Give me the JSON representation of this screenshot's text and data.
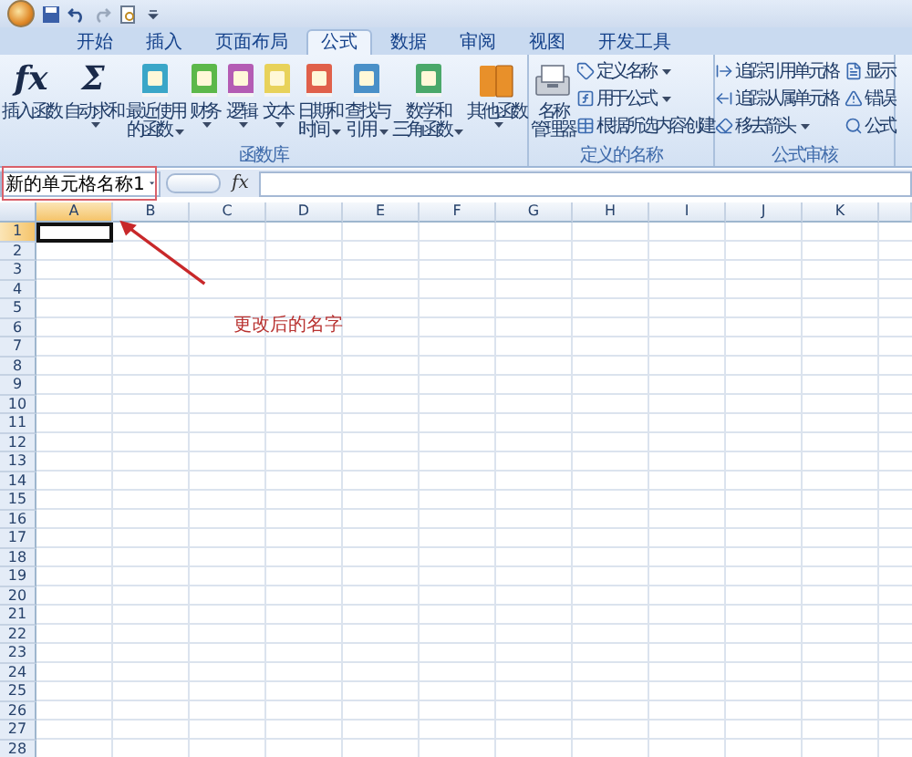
{
  "tabs": [
    {
      "label": "开始",
      "selected": false
    },
    {
      "label": "插入",
      "selected": false
    },
    {
      "label": "页面布局",
      "selected": false
    },
    {
      "label": "公式",
      "selected": true
    },
    {
      "label": "数据",
      "selected": false
    },
    {
      "label": "审阅",
      "selected": false
    },
    {
      "label": "视图",
      "selected": false
    },
    {
      "label": "开发工具",
      "selected": false
    }
  ],
  "ribbon_groups": [
    {
      "label": "函数库",
      "large": [
        {
          "kind": "glyph",
          "icon_text": "fx",
          "lines": [
            "插入函数"
          ],
          "dropdown": false
        },
        {
          "kind": "glyph",
          "icon_text": "Σ",
          "lines": [
            "自动求和"
          ],
          "dropdown": true
        },
        {
          "kind": "book",
          "color": "#3aa6c8",
          "lines": [
            "最近使用",
            "的函数"
          ],
          "dropdown": true
        },
        {
          "kind": "book",
          "color": "#5cb84a",
          "lines": [
            "财务"
          ],
          "dropdown": true
        },
        {
          "kind": "book",
          "color": "#b45cb4",
          "lines": [
            "逻辑"
          ],
          "dropdown": true
        },
        {
          "kind": "book",
          "color": "#e8d25a",
          "lines": [
            "文本"
          ],
          "dropdown": true
        },
        {
          "kind": "book",
          "color": "#e0604a",
          "lines": [
            "日期和",
            "时间"
          ],
          "dropdown": true
        },
        {
          "kind": "book",
          "color": "#4a90c8",
          "lines": [
            "查找与",
            "引用"
          ],
          "dropdown": true
        },
        {
          "kind": "book",
          "color": "#4aa86a",
          "lines": [
            "数学和",
            "三角函数"
          ],
          "dropdown": true
        },
        {
          "kind": "books",
          "color": "#e8902a",
          "lines": [
            "其他函数"
          ],
          "dropdown": true
        }
      ]
    },
    {
      "label": "定义的名称",
      "large": [
        {
          "kind": "manager",
          "lines": [
            "名称",
            "管理器"
          ],
          "dropdown": false
        }
      ],
      "small": [
        {
          "kind": "tag",
          "label": "定义名称",
          "dropdown": true
        },
        {
          "kind": "formula",
          "label": "用于公式",
          "dropdown": true
        },
        {
          "kind": "table",
          "label": "根据所选内容创建",
          "dropdown": false
        }
      ]
    },
    {
      "label": "公式审核",
      "small": [
        {
          "kind": "trace-right",
          "label": "追踪引用单元格",
          "dropdown": false
        },
        {
          "kind": "trace-left",
          "label": "追踪从属单元格",
          "dropdown": false
        },
        {
          "kind": "eraser",
          "label": "移去箭头",
          "dropdown": true
        },
        {
          "kind": "document",
          "label": "显示",
          "dropdown": false
        },
        {
          "kind": "warning",
          "label": "错误",
          "dropdown": false
        },
        {
          "kind": "magnifier",
          "label": "公式",
          "dropdown": false
        }
      ]
    }
  ],
  "formula_bar": {
    "name_box": "新的单元格名称1",
    "fx_label": "fx"
  },
  "sheet": {
    "columns": [
      {
        "label": "A",
        "selected": true
      },
      {
        "label": "B",
        "selected": false
      },
      {
        "label": "C",
        "selected": false
      },
      {
        "label": "D",
        "selected": false
      },
      {
        "label": "E",
        "selected": false
      },
      {
        "label": "F",
        "selected": false
      },
      {
        "label": "G",
        "selected": false
      },
      {
        "label": "H",
        "selected": false
      },
      {
        "label": "I",
        "selected": false
      },
      {
        "label": "J",
        "selected": false
      },
      {
        "label": "K",
        "selected": false
      }
    ],
    "rows": [
      {
        "label": "1",
        "selected": true
      },
      {
        "label": "2",
        "selected": false
      },
      {
        "label": "3",
        "selected": false
      },
      {
        "label": "4",
        "selected": false
      },
      {
        "label": "5",
        "selected": false
      },
      {
        "label": "6",
        "selected": false
      },
      {
        "label": "7",
        "selected": false
      },
      {
        "label": "8",
        "selected": false
      },
      {
        "label": "9",
        "selected": false
      },
      {
        "label": "10",
        "selected": false
      },
      {
        "label": "11",
        "selected": false
      },
      {
        "label": "12",
        "selected": false
      },
      {
        "label": "13",
        "selected": false
      },
      {
        "label": "14",
        "selected": false
      },
      {
        "label": "15",
        "selected": false
      },
      {
        "label": "16",
        "selected": false
      },
      {
        "label": "17",
        "selected": false
      },
      {
        "label": "18",
        "selected": false
      },
      {
        "label": "19",
        "selected": false
      },
      {
        "label": "20",
        "selected": false
      },
      {
        "label": "21",
        "selected": false
      },
      {
        "label": "22",
        "selected": false
      },
      {
        "label": "23",
        "selected": false
      },
      {
        "label": "24",
        "selected": false
      },
      {
        "label": "25",
        "selected": false
      },
      {
        "label": "26",
        "selected": false
      },
      {
        "label": "27",
        "selected": false
      },
      {
        "label": "28",
        "selected": false
      }
    ]
  },
  "annotation": {
    "text": "更改后的名字"
  }
}
